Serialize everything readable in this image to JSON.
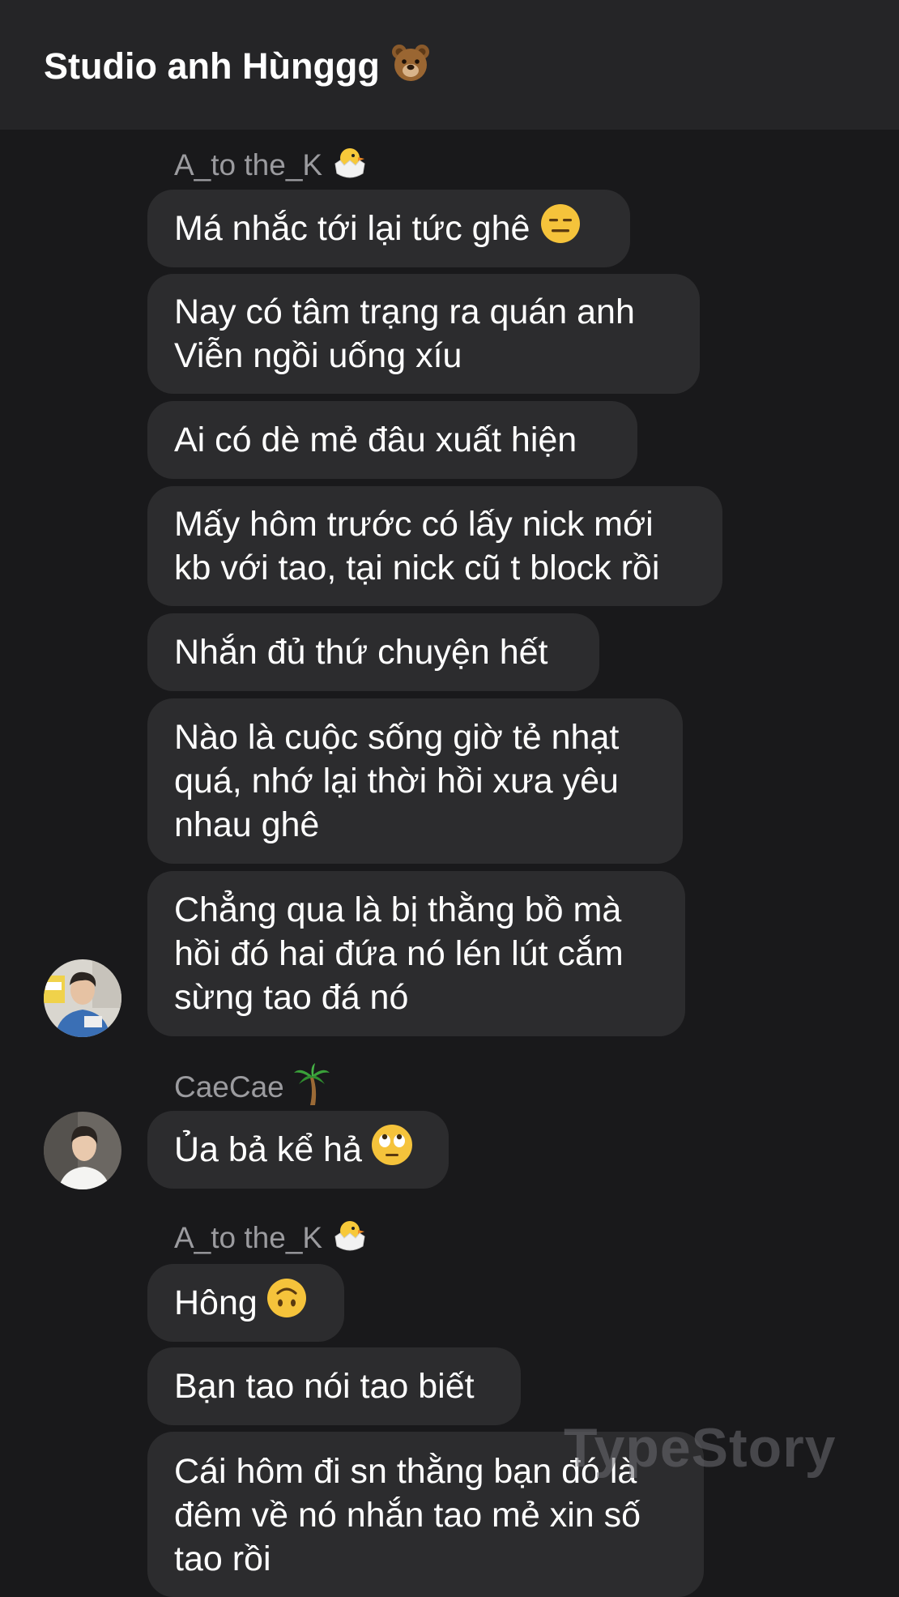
{
  "header": {
    "title": "Studio anh Hùnggg",
    "title_emoji": "bear-face"
  },
  "groups": [
    {
      "sender": "A_to the_K",
      "sender_emoji": "hatching-chick",
      "avatar": "avatar-a-to-the-k",
      "messages": [
        {
          "text": "Má nhắc tới lại tức ghê",
          "emoji": "expressionless-face"
        },
        {
          "text": "Nay có tâm trạng ra quán anh\nViễn ngồi uống xíu"
        },
        {
          "text": "Ai có dè mẻ đâu xuất hiện"
        },
        {
          "text": "Mấy hôm trước có lấy nick mới\nkb với tao, tại nick cũ t block rồi"
        },
        {
          "text": "Nhắn đủ thứ chuyện hết"
        },
        {
          "text": "Nào là cuộc sống giờ tẻ nhạt\nquá, nhớ lại thời hồi xưa yêu\nnhau ghê"
        },
        {
          "text": "Chẳng qua là bị thằng bồ mà\nhồi đó hai đứa nó lén lút cắm\nsừng tao đá nó"
        }
      ]
    },
    {
      "sender": "CaeCae",
      "sender_emoji": "palm-tree",
      "avatar": "avatar-caecae",
      "messages": [
        {
          "text": "Ủa bả kể hả",
          "emoji": "face-with-rolling-eyes"
        }
      ]
    },
    {
      "sender": "A_to the_K",
      "sender_emoji": "hatching-chick",
      "messages": [
        {
          "text": "Hông",
          "emoji": "upside-down-face"
        },
        {
          "text": "Bạn tao nói tao biết"
        },
        {
          "text": "Cái hôm đi sn thằng bạn đó là\nđêm về nó nhắn tao mẻ xin số\ntao rồi"
        }
      ]
    }
  ],
  "watermark": "TypeStory",
  "colors": {
    "background": "#19191b",
    "header": "#252527",
    "bubble": "#2c2c2e",
    "sender_text": "#9b9b9f",
    "emoji_yellow": "#f5c33b"
  }
}
